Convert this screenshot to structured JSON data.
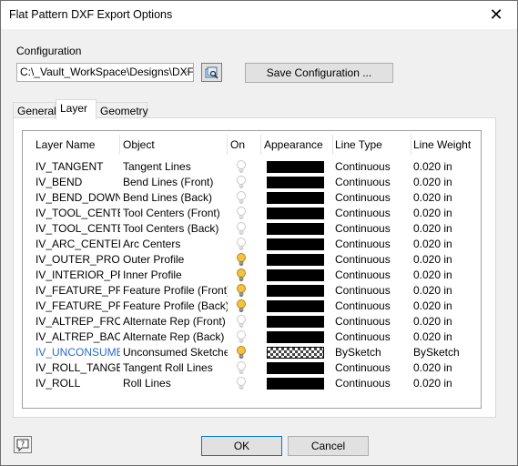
{
  "window": {
    "title": "Flat Pattern DXF Export Options",
    "close_label": "✕"
  },
  "configuration": {
    "label": "Configuration",
    "selected": "C:\\_Vault_WorkSpace\\Designs\\DXF.",
    "save_button": "Save Configuration ..."
  },
  "tabs": [
    {
      "label": "General",
      "active": false
    },
    {
      "label": "Layer",
      "active": true
    },
    {
      "label": "Geometry",
      "active": false
    }
  ],
  "grid": {
    "headers": {
      "layer_name": "Layer Name",
      "object": "Object",
      "on": "On",
      "appearance": "Appearance",
      "line_type": "Line Type",
      "line_weight": "Line Weight"
    },
    "rows": [
      {
        "layer": "IV_TANGENT",
        "object": "Tangent Lines",
        "on": false,
        "appearance": "black",
        "line_type": "Continuous",
        "line_weight": "0.020 in"
      },
      {
        "layer": "IV_BEND",
        "object": "Bend Lines (Front)",
        "on": false,
        "appearance": "black",
        "line_type": "Continuous",
        "line_weight": "0.020 in"
      },
      {
        "layer": "IV_BEND_DOWN",
        "object": "Bend Lines (Back)",
        "on": false,
        "appearance": "black",
        "line_type": "Continuous",
        "line_weight": "0.020 in"
      },
      {
        "layer": "IV_TOOL_CENTER",
        "object": "Tool Centers (Front)",
        "on": false,
        "appearance": "black",
        "line_type": "Continuous",
        "line_weight": "0.020 in"
      },
      {
        "layer": "IV_TOOL_CENTER",
        "object": "Tool Centers (Back)",
        "on": false,
        "appearance": "black",
        "line_type": "Continuous",
        "line_weight": "0.020 in"
      },
      {
        "layer": "IV_ARC_CENTERS",
        "object": "Arc Centers",
        "on": false,
        "appearance": "black",
        "line_type": "Continuous",
        "line_weight": "0.020 in"
      },
      {
        "layer": "IV_OUTER_PROFI",
        "object": "Outer Profile",
        "on": true,
        "appearance": "black",
        "line_type": "Continuous",
        "line_weight": "0.020 in"
      },
      {
        "layer": "IV_INTERIOR_PR",
        "object": "Inner Profile",
        "on": true,
        "appearance": "black",
        "line_type": "Continuous",
        "line_weight": "0.020 in"
      },
      {
        "layer": "IV_FEATURE_PRC",
        "object": "Feature Profile (Front)",
        "on": true,
        "appearance": "black",
        "line_type": "Continuous",
        "line_weight": "0.020 in"
      },
      {
        "layer": "IV_FEATURE_PRC",
        "object": "Feature Profile (Back)",
        "on": true,
        "appearance": "black",
        "line_type": "Continuous",
        "line_weight": "0.020 in"
      },
      {
        "layer": "IV_ALTREP_FRON",
        "object": "Alternate Rep (Front)",
        "on": false,
        "appearance": "black",
        "line_type": "Continuous",
        "line_weight": "0.020 in"
      },
      {
        "layer": "IV_ALTREP_BACK",
        "object": "Alternate Rep (Back)",
        "on": false,
        "appearance": "black",
        "line_type": "Continuous",
        "line_weight": "0.020 in"
      },
      {
        "layer": "IV_UNCONSUMED",
        "object": "Unconsumed Sketches",
        "on": true,
        "appearance": "checker",
        "line_type": "BySketch",
        "line_weight": "BySketch",
        "highlight": true
      },
      {
        "layer": "IV_ROLL_TANGEN",
        "object": "Tangent Roll Lines",
        "on": false,
        "appearance": "black",
        "line_type": "Continuous",
        "line_weight": "0.020 in"
      },
      {
        "layer": "IV_ROLL",
        "object": "Roll Lines",
        "on": false,
        "appearance": "black",
        "line_type": "Continuous",
        "line_weight": "0.020 in"
      }
    ]
  },
  "buttons": {
    "ok": "OK",
    "cancel": "Cancel",
    "help_icon": "help-icon"
  },
  "colors": {
    "bulb_on": "#f5c242",
    "bulb_off": "#d8d8d8",
    "highlight_text": "#2a6cc9"
  }
}
